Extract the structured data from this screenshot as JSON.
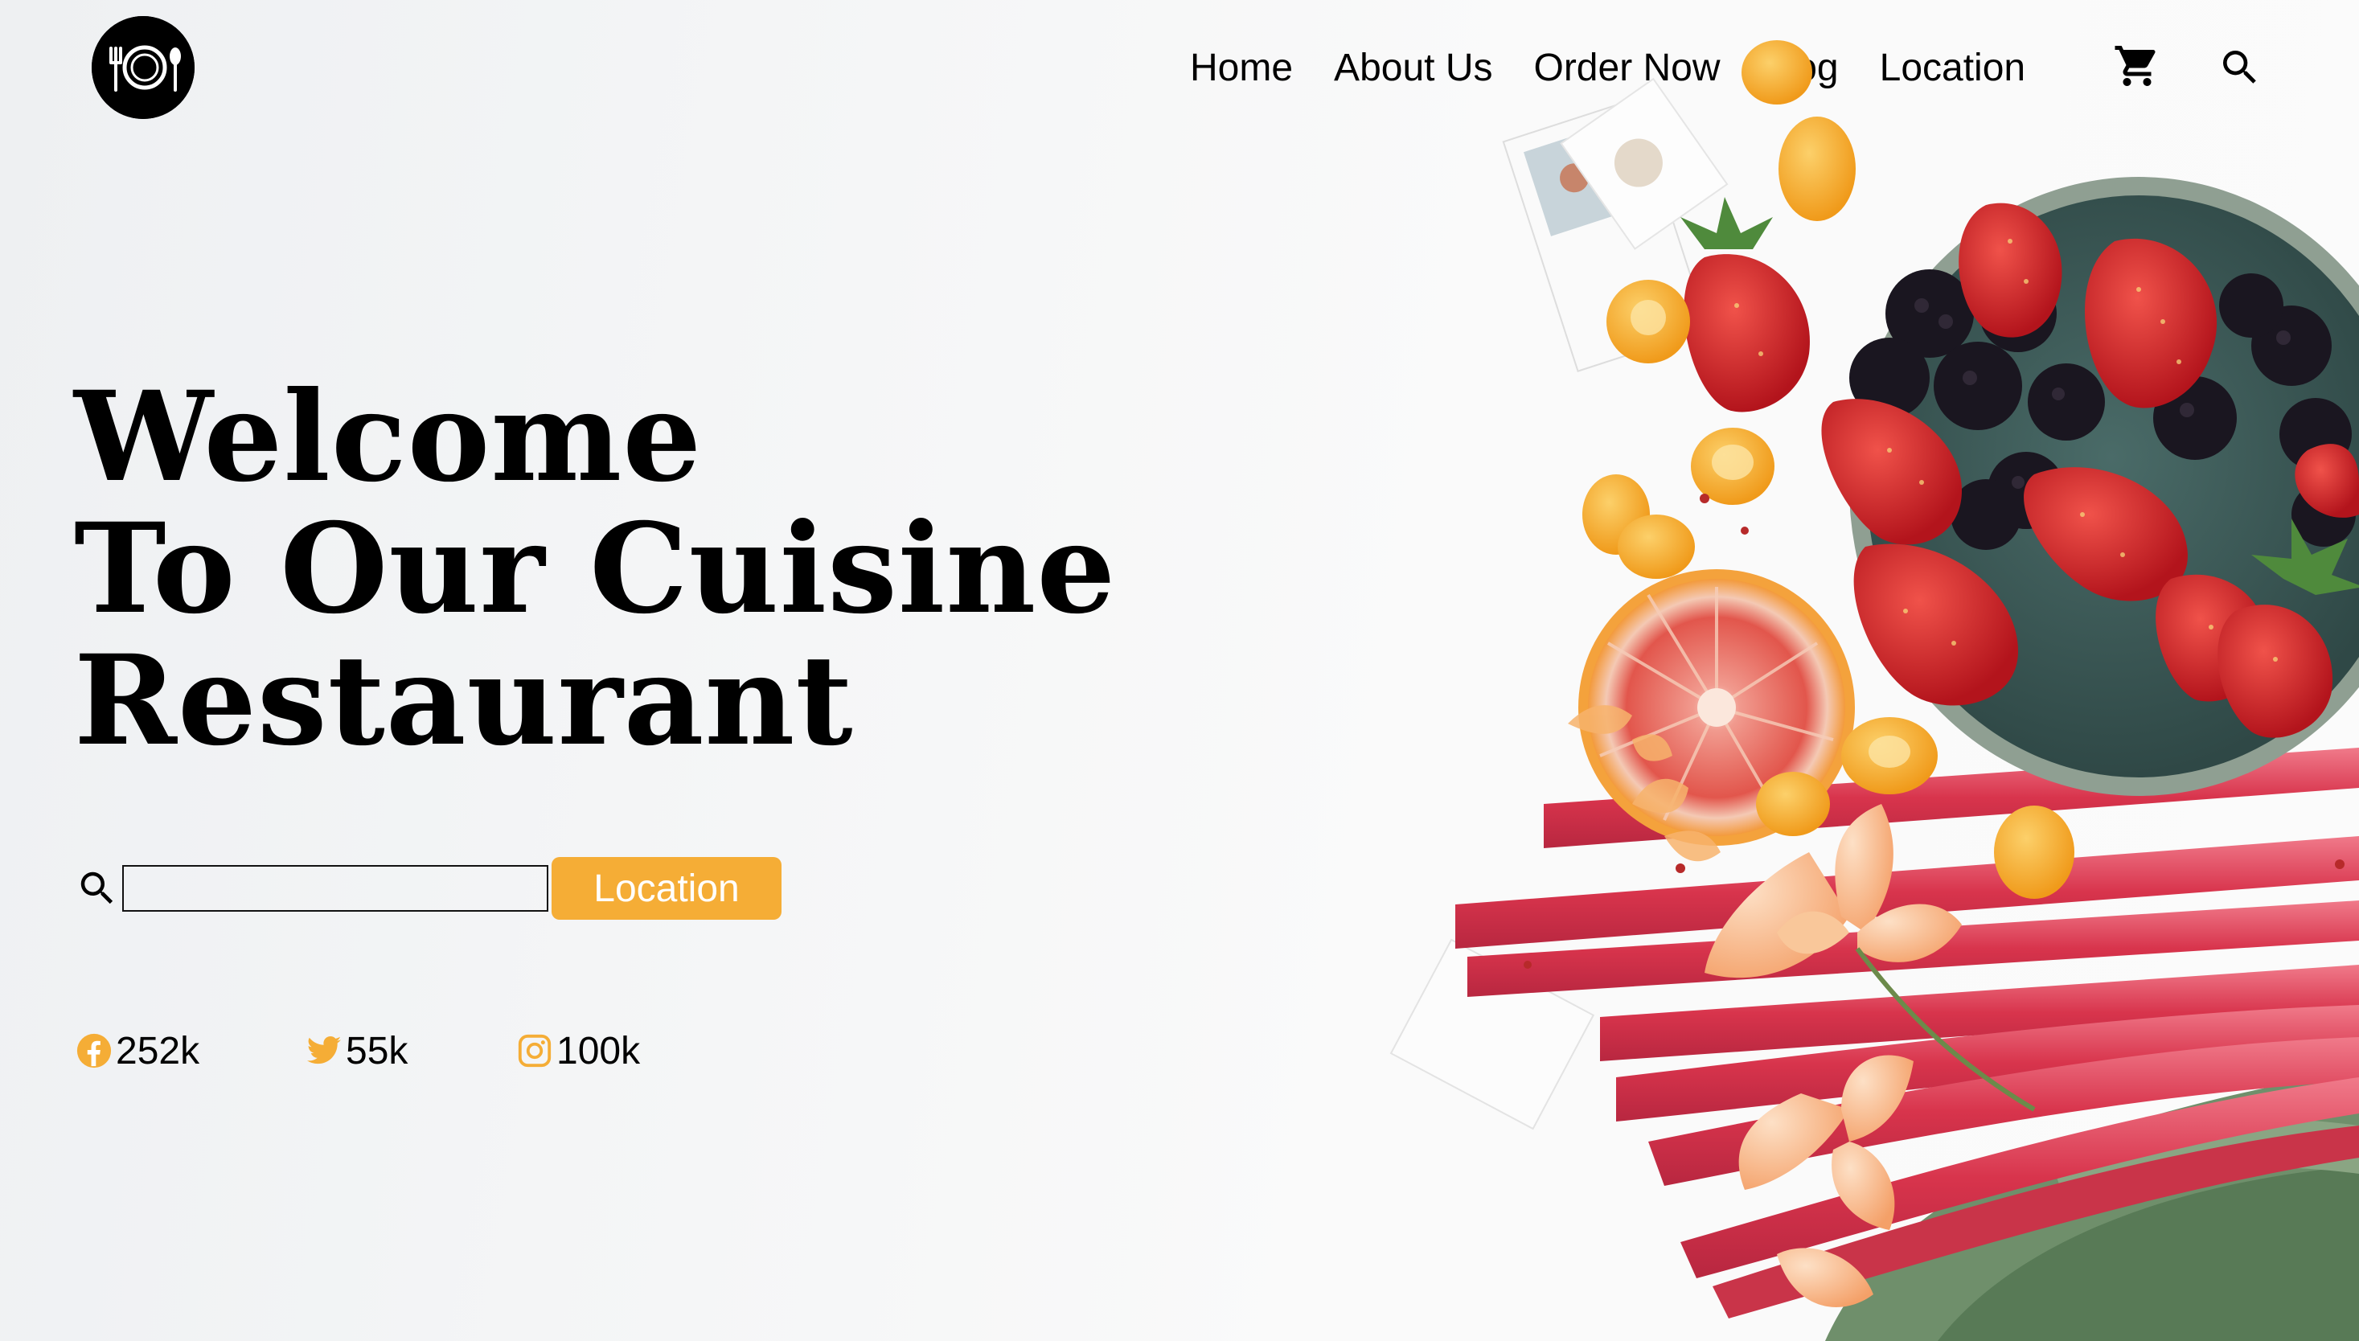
{
  "header": {
    "logo_icon": "plate-fork-spoon-icon",
    "nav": [
      {
        "label": "Home"
      },
      {
        "label": "About Us"
      },
      {
        "label": "Order Now"
      },
      {
        "label": "Blog"
      },
      {
        "label": "Location"
      }
    ],
    "cart_icon": "cart-icon",
    "search_icon": "search-icon"
  },
  "hero": {
    "title_lines": [
      "Welcome",
      "To Our Cuisine",
      "Restaurant"
    ],
    "search": {
      "icon": "search-icon",
      "value": "",
      "placeholder": "",
      "button_label": "Location"
    }
  },
  "socials": [
    {
      "icon": "facebook-icon",
      "count": "252k"
    },
    {
      "icon": "twitter-icon",
      "count": "55k"
    },
    {
      "icon": "instagram-icon",
      "count": "100k"
    }
  ],
  "colors": {
    "accent": "#f5ad36",
    "text": "#000000",
    "background": "#f5f6f7"
  },
  "image": {
    "subject": "bowl of strawberries and blackberries, blood orange, rhubarb stalks, kumquats and orange flowers on white table"
  }
}
